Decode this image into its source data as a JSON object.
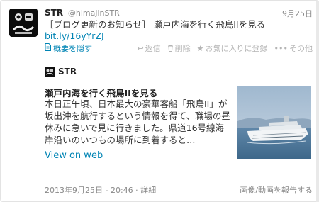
{
  "tweet": {
    "name": "STR",
    "handle": "@himajinSTR",
    "date": "9月25日",
    "text": "［ブログ更新のお知らせ］ 瀬戸内海を行く飛鳥IIを見る",
    "link": "bit.ly/16yYrZJ"
  },
  "actions": {
    "collapse": "概要を隠す",
    "reply": "返信",
    "delete": "削除",
    "favorite": "お気に入りに登録",
    "more": "その他"
  },
  "card": {
    "brand": "STR",
    "title": "瀬戸内海を行く飛鳥IIを見る",
    "description": "本日正午頃、日本最大の豪華客船「飛鳥II」が坂出沖を航行するという情報を得て、職場の昼休みに急いで見に行きました。県道16号線海岸沿いのいつもの場所に到着すると…",
    "view_link": "View on web"
  },
  "footer": {
    "timestamp": "2013年9月25日 - 20:46",
    "separator": " · ",
    "details": "詳細",
    "report": "画像/動画を報告する"
  },
  "colors": {
    "link": "#0084b4",
    "muted": "#888888",
    "action_disabled": "#b4b4b4"
  },
  "icons": {
    "avatar": "avatar-image",
    "collapse": "document-icon",
    "reply": "reply-icon",
    "delete": "trash-icon",
    "favorite": "star-icon",
    "more": "ellipsis-icon"
  }
}
